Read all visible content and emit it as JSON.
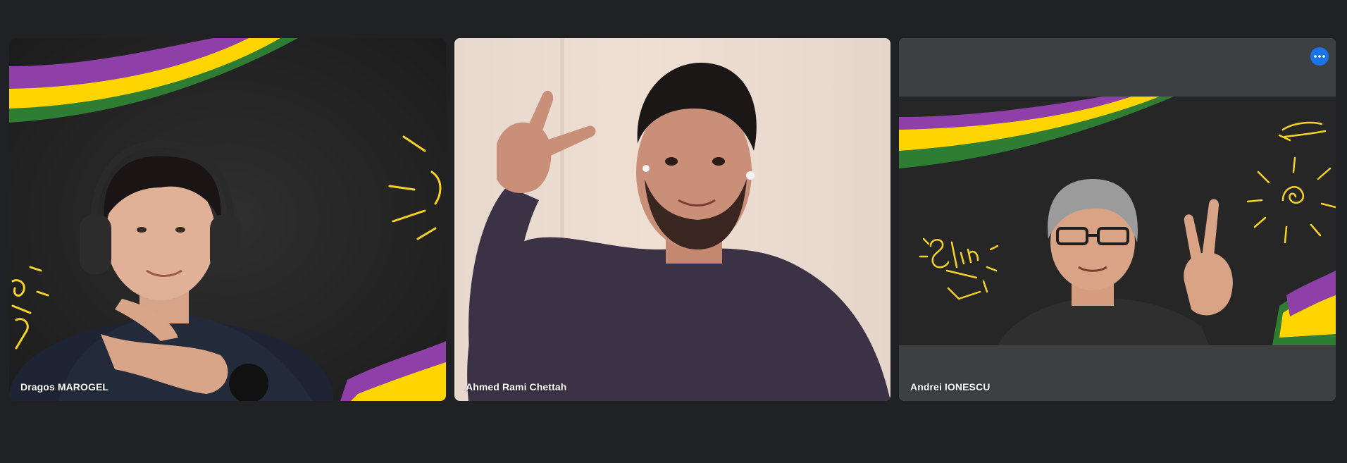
{
  "participants": [
    {
      "name": "Dragos MAROGEL",
      "background": "chalkboard-stripes"
    },
    {
      "name": "Ahmed Rami Chettah",
      "background": "room-wall"
    },
    {
      "name": "Andrei IONESCU",
      "background": "chalkboard-stripes",
      "active_speaker": true
    }
  ],
  "icons": {
    "more_options": "more-horizontal-icon"
  },
  "colors": {
    "page_background": "#202124",
    "tile_background": "#3c4043",
    "active_border": "#8ab4f8",
    "more_button": "#1a73e8",
    "stripe_purple": "#8e3fa8",
    "stripe_yellow": "#ffd500",
    "stripe_green": "#2e7d32",
    "doodle_yellow": "#f7d226"
  }
}
